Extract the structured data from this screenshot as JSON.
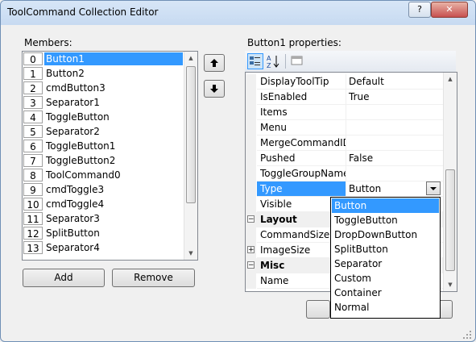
{
  "window": {
    "title": "ToolCommand Collection Editor",
    "help_glyph": "?",
    "close_glyph": "✕"
  },
  "members": {
    "label": "Members:",
    "items": [
      {
        "index": "0",
        "name": "Button1"
      },
      {
        "index": "1",
        "name": "Button2"
      },
      {
        "index": "2",
        "name": "cmdButton3"
      },
      {
        "index": "3",
        "name": "Separator1"
      },
      {
        "index": "4",
        "name": "ToggleButton"
      },
      {
        "index": "5",
        "name": "Separator2"
      },
      {
        "index": "6",
        "name": "ToggleButton1"
      },
      {
        "index": "7",
        "name": "ToggleButton2"
      },
      {
        "index": "8",
        "name": "ToolCommand0"
      },
      {
        "index": "9",
        "name": "cmdToggle3"
      },
      {
        "index": "10",
        "name": "cmdToggle4"
      },
      {
        "index": "11",
        "name": "Separator3"
      },
      {
        "index": "12",
        "name": "SplitButton"
      },
      {
        "index": "13",
        "name": "Separator4"
      }
    ],
    "selected_index": 0,
    "add_label": "Add",
    "remove_label": "Remove"
  },
  "properties": {
    "label": "Button1 properties:",
    "rows": [
      {
        "kind": "prop",
        "name": "DisplayToolTip",
        "value": "Default"
      },
      {
        "kind": "prop",
        "name": "IsEnabled",
        "value": "True"
      },
      {
        "kind": "prop",
        "name": "Items",
        "value": ""
      },
      {
        "kind": "prop",
        "name": "Menu",
        "value": ""
      },
      {
        "kind": "prop",
        "name": "MergeCommandID",
        "value": ""
      },
      {
        "kind": "prop",
        "name": "Pushed",
        "value": "False"
      },
      {
        "kind": "prop",
        "name": "ToggleGroupName",
        "value": ""
      },
      {
        "kind": "prop",
        "name": "Type",
        "value": "Button",
        "selected": true
      },
      {
        "kind": "prop",
        "name": "Visible",
        "value": ""
      },
      {
        "kind": "category",
        "name": "Layout",
        "expander": "−"
      },
      {
        "kind": "prop",
        "name": "CommandSize",
        "value": ""
      },
      {
        "kind": "prop",
        "name": "ImageSize",
        "value": "",
        "expander": "+"
      },
      {
        "kind": "category",
        "name": "Misc",
        "expander": "−"
      },
      {
        "kind": "prop",
        "name": "Name",
        "value": ""
      }
    ]
  },
  "type_dropdown": {
    "options": [
      "Button",
      "ToggleButton",
      "DropDownButton",
      "SplitButton",
      "Separator",
      "Custom",
      "Container",
      "Normal"
    ],
    "selected": "Button"
  }
}
